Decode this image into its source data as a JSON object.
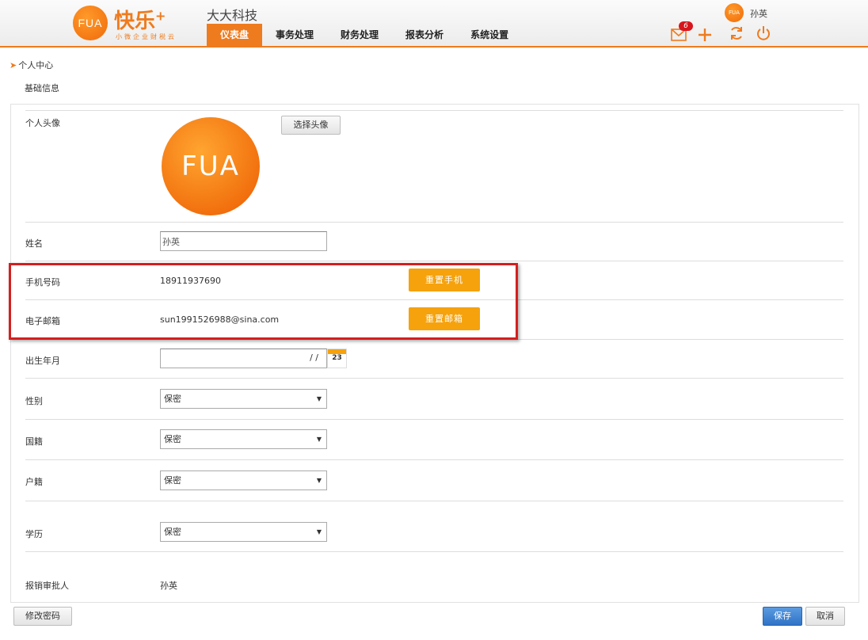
{
  "header": {
    "logo_text": "FUA",
    "brand_name": "快乐",
    "brand_plus": "+",
    "slogan": "小微企业财税云",
    "company": "大大科技",
    "user_avatar_text": "FUA",
    "user_name": "孙英",
    "mail_badge": "6",
    "nav": [
      {
        "label": "仪表盘",
        "active": true
      },
      {
        "label": "事务处理",
        "active": false
      },
      {
        "label": "财务处理",
        "active": false
      },
      {
        "label": "报表分析",
        "active": false
      },
      {
        "label": "系统设置",
        "active": false
      }
    ]
  },
  "breadcrumb": "个人中心",
  "section_title": "基础信息",
  "form": {
    "avatar": {
      "label": "个人头像",
      "button": "选择头像",
      "image_text": "FUA"
    },
    "name": {
      "label": "姓名",
      "value": "孙英"
    },
    "phone": {
      "label": "手机号码",
      "value": "18911937690",
      "button": "重置手机"
    },
    "email": {
      "label": "电子邮箱",
      "value": "sun1991526988@sina.com",
      "button": "重置邮箱"
    },
    "birth": {
      "label": "出生年月",
      "value": "/ /",
      "calendar_day": "23"
    },
    "gender": {
      "label": "性别",
      "value": "保密"
    },
    "nationality": {
      "label": "国籍",
      "value": "保密"
    },
    "household": {
      "label": "户籍",
      "value": "保密"
    },
    "education": {
      "label": "学历",
      "value": "保密"
    },
    "approver": {
      "label": "报销审批人",
      "value": "孙英"
    }
  },
  "footer": {
    "change_password": "修改密码",
    "save": "保存",
    "cancel": "取消"
  },
  "colors": {
    "accent": "#ee7b1e",
    "button_orange": "#f5a20d",
    "highlight": "#d41f1f",
    "primary_blue": "#2f73c6"
  }
}
